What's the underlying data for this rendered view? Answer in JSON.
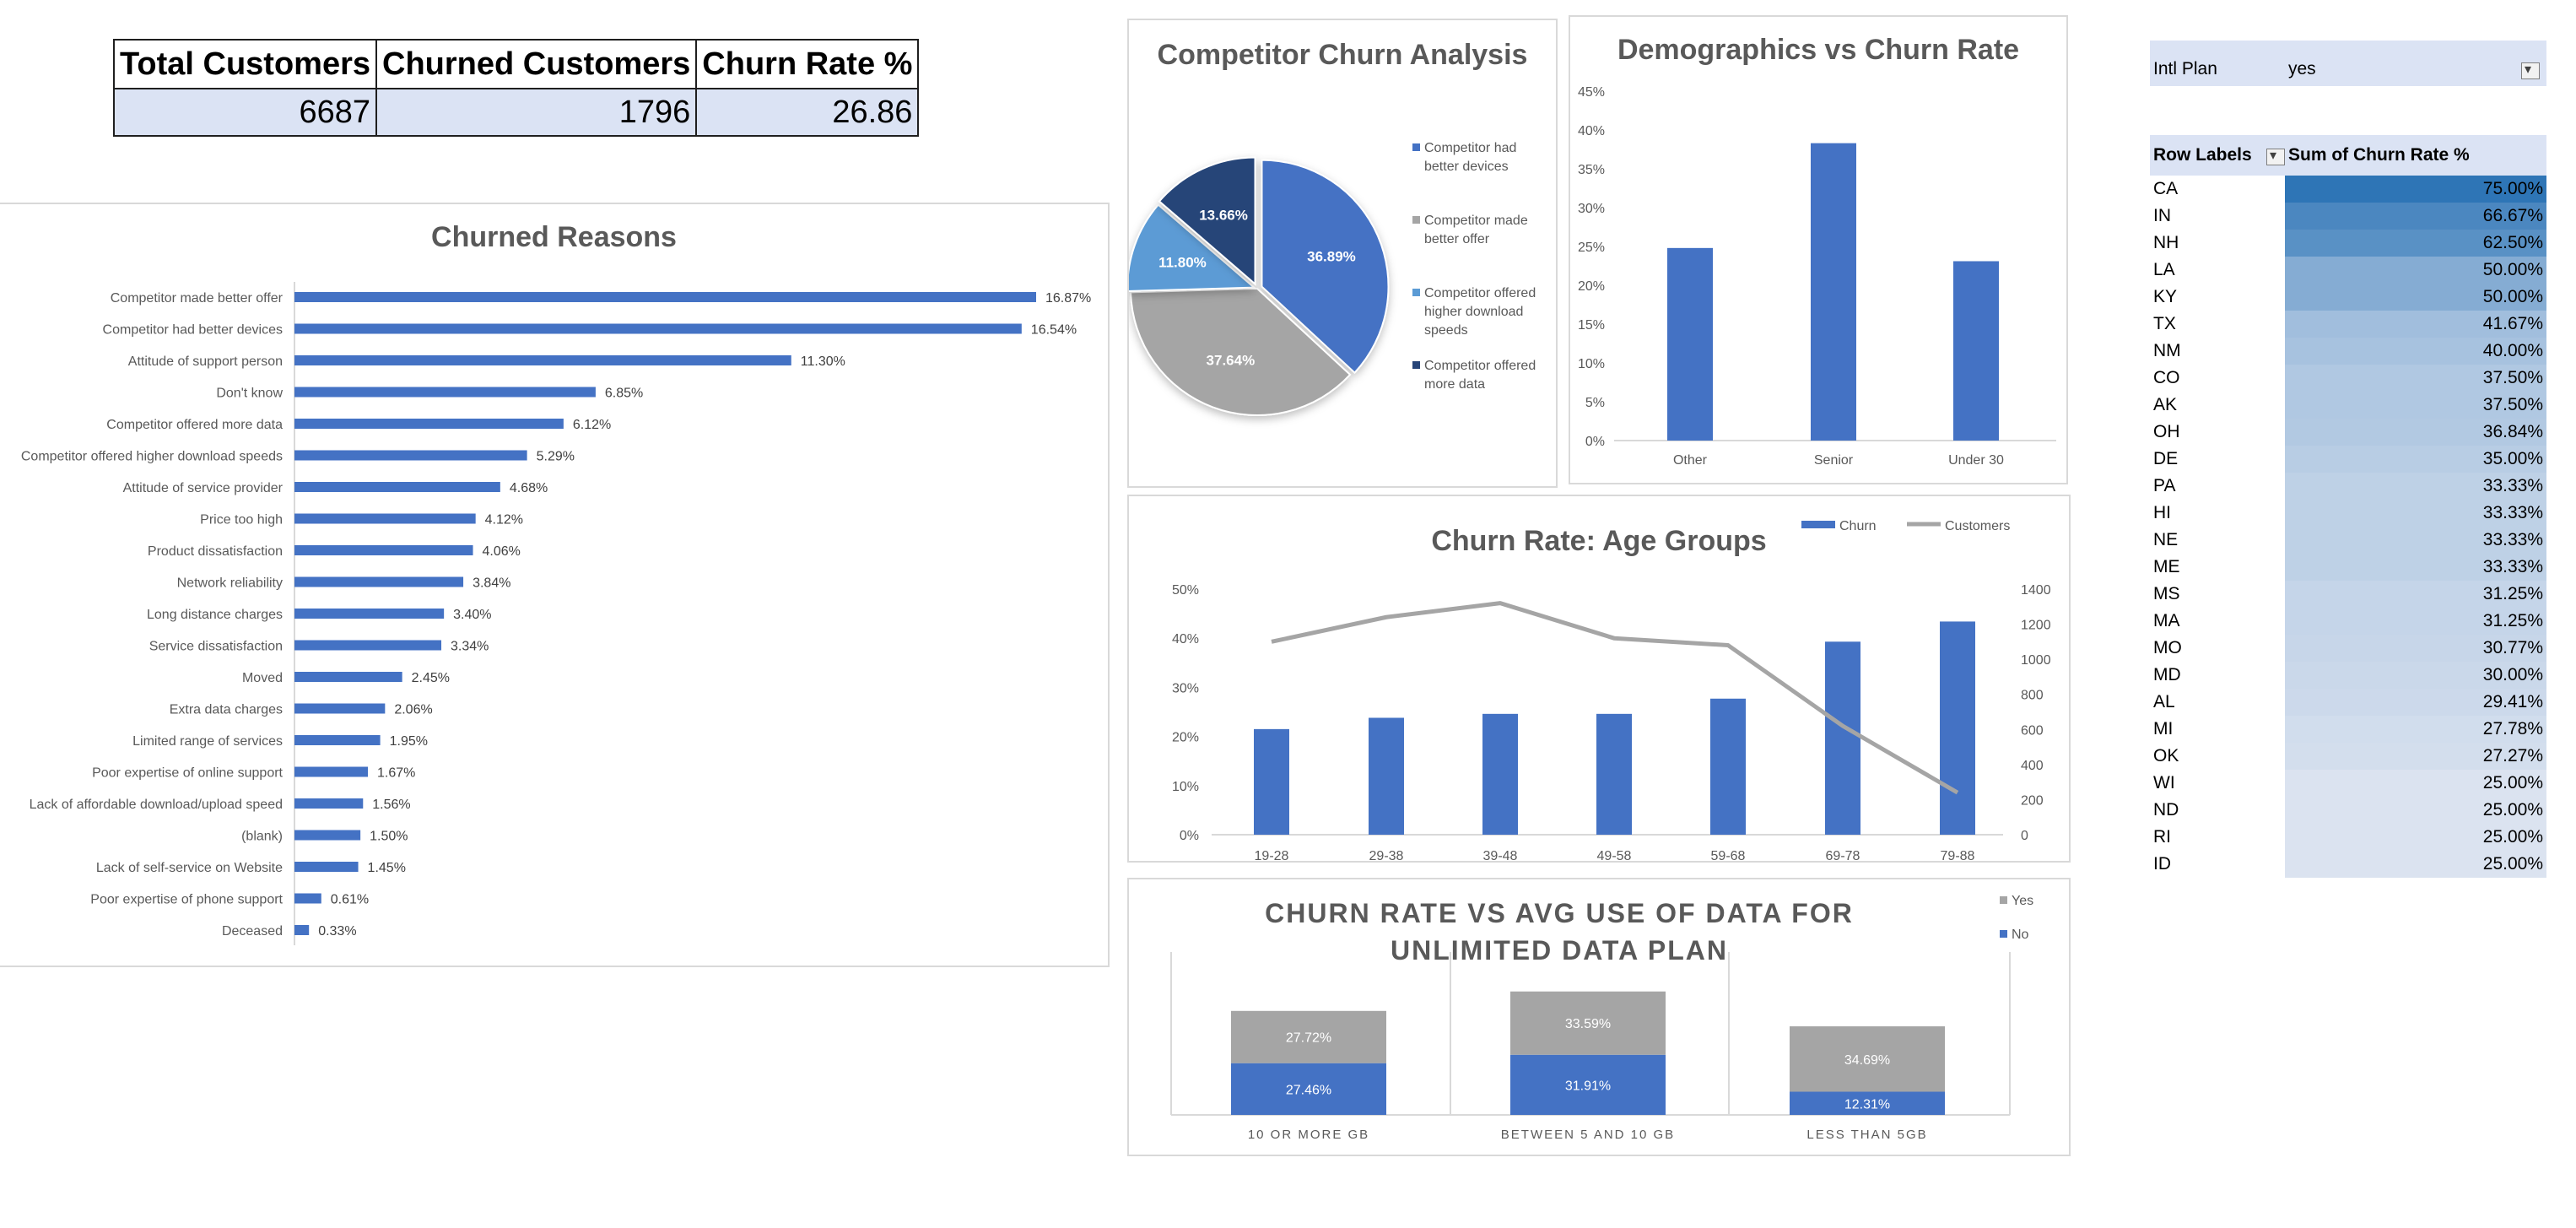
{
  "kpi": {
    "headers": [
      "Total Customers",
      "Churned Customers",
      "Churn Rate %"
    ],
    "values": [
      "6687",
      "1796",
      "26.86"
    ]
  },
  "colors": {
    "blue": "#4472c4",
    "gray": "#a5a5a5",
    "light_blue": "#5b9bd5",
    "navy": "#264478"
  },
  "chart_data": [
    {
      "type": "bar",
      "orientation": "horizontal",
      "title": "Churned Reasons",
      "categories": [
        "Competitor made better offer",
        "Competitor had better devices",
        "Attitude of support person",
        "Don't know",
        "Competitor offered more data",
        "Competitor offered higher download speeds",
        "Attitude of service provider",
        "Price too high",
        "Product dissatisfaction",
        "Network reliability",
        "Long distance charges",
        "Service dissatisfaction",
        "Moved",
        "Extra data charges",
        "Limited range of services",
        "Poor expertise of online support",
        "Lack of affordable download/upload speed",
        "(blank)",
        "Lack of self-service on Website",
        "Poor expertise of phone support",
        "Deceased"
      ],
      "values": [
        16.87,
        16.54,
        11.3,
        6.85,
        6.12,
        5.29,
        4.68,
        4.12,
        4.06,
        3.84,
        3.4,
        3.34,
        2.45,
        2.06,
        1.95,
        1.67,
        1.56,
        1.5,
        1.45,
        0.61,
        0.33
      ],
      "labels": [
        "16.87%",
        "16.54%",
        "11.30%",
        "6.85%",
        "6.12%",
        "5.29%",
        "4.68%",
        "4.12%",
        "4.06%",
        "3.84%",
        "3.40%",
        "3.34%",
        "2.45%",
        "2.06%",
        "1.95%",
        "1.67%",
        "1.56%",
        "1.50%",
        "1.45%",
        "0.61%",
        "0.33%"
      ]
    },
    {
      "type": "pie",
      "title": "Competitor Churn Analysis",
      "categories": [
        "Competitor had better devices",
        "Competitor made better offer",
        "Competitor offered higher download speeds",
        "Competitor offered more data"
      ],
      "values": [
        36.89,
        37.64,
        11.8,
        13.66
      ],
      "labels": [
        "36.89%",
        "37.64%",
        "11.80%",
        "13.66%"
      ],
      "legend_lines": [
        [
          "Competitor had",
          "better devices"
        ],
        [
          "Competitor made",
          "better offer"
        ],
        [
          "Competitor offered",
          "higher download",
          "speeds"
        ],
        [
          "Competitor offered",
          "more data"
        ]
      ],
      "legend": "right"
    },
    {
      "type": "bar",
      "title": "Demographics vs Churn Rate",
      "categories": [
        "Other",
        "Senior",
        "Under 30"
      ],
      "values": [
        24.8,
        38.3,
        23.1
      ],
      "ylim": [
        0,
        45
      ],
      "y_ticks": [
        "0%",
        "5%",
        "10%",
        "15%",
        "20%",
        "25%",
        "30%",
        "35%",
        "40%",
        "45%"
      ],
      "grid": false
    },
    {
      "type": "bar",
      "title": "Churn Rate: Age Groups",
      "categories": [
        "19-28",
        "29-38",
        "39-48",
        "49-58",
        "59-68",
        "69-78",
        "79-88"
      ],
      "series": [
        {
          "name": "Churn",
          "kind": "bar",
          "axis": "left",
          "values": [
            21.5,
            23.8,
            24.6,
            24.6,
            27.7,
            39.3,
            43.4
          ]
        },
        {
          "name": "Customers",
          "kind": "line",
          "axis": "right",
          "values": [
            1100,
            1240,
            1320,
            1120,
            1080,
            620,
            240
          ]
        }
      ],
      "ylim": [
        0,
        50
      ],
      "y_ticks": [
        "0%",
        "10%",
        "20%",
        "30%",
        "40%",
        "50%"
      ],
      "y2lim": [
        0,
        1400
      ],
      "y2_ticks": [
        "0",
        "200",
        "400",
        "600",
        "800",
        "1000",
        "1200",
        "1400"
      ],
      "legend": "top-right"
    },
    {
      "type": "bar",
      "stacked": true,
      "title": "CHURN RATE VS AVG USE OF DATA FOR UNLIMITED DATA PLAN",
      "categories": [
        "10 OR MORE GB",
        "BETWEEN 5 AND 10 GB",
        "LESS THAN 5GB"
      ],
      "series": [
        {
          "name": "No",
          "values": [
            27.46,
            31.91,
            12.31
          ],
          "labels": [
            "27.46%",
            "31.91%",
            "12.31%"
          ]
        },
        {
          "name": "Yes",
          "values": [
            27.72,
            33.59,
            34.69
          ],
          "labels": [
            "27.72%",
            "33.59%",
            "34.69%"
          ]
        }
      ],
      "legend": "top-right"
    },
    {
      "type": "table",
      "title": "",
      "filter_label": "Intl Plan",
      "filter_value": "yes",
      "columns": [
        "Row Labels",
        "Sum of Churn Rate %"
      ],
      "rows": [
        [
          "CA",
          "75.00%"
        ],
        [
          "IN",
          "66.67%"
        ],
        [
          "NH",
          "62.50%"
        ],
        [
          "LA",
          "50.00%"
        ],
        [
          "KY",
          "50.00%"
        ],
        [
          "TX",
          "41.67%"
        ],
        [
          "NM",
          "40.00%"
        ],
        [
          "CO",
          "37.50%"
        ],
        [
          "AK",
          "37.50%"
        ],
        [
          "OH",
          "36.84%"
        ],
        [
          "DE",
          "35.00%"
        ],
        [
          "PA",
          "33.33%"
        ],
        [
          "HI",
          "33.33%"
        ],
        [
          "NE",
          "33.33%"
        ],
        [
          "ME",
          "33.33%"
        ],
        [
          "MS",
          "31.25%"
        ],
        [
          "MA",
          "31.25%"
        ],
        [
          "MO",
          "30.77%"
        ],
        [
          "MD",
          "30.00%"
        ],
        [
          "AL",
          "29.41%"
        ],
        [
          "MI",
          "27.78%"
        ],
        [
          "OK",
          "27.27%"
        ],
        [
          "WI",
          "25.00%"
        ],
        [
          "ND",
          "25.00%"
        ],
        [
          "RI",
          "25.00%"
        ],
        [
          "ID",
          "25.00%"
        ]
      ],
      "values": [
        75.0,
        66.67,
        62.5,
        50.0,
        50.0,
        41.67,
        40.0,
        37.5,
        37.5,
        36.84,
        35.0,
        33.33,
        33.33,
        33.33,
        33.33,
        31.25,
        31.25,
        30.77,
        30.0,
        29.41,
        27.78,
        27.27,
        25.0,
        25.0,
        25.0,
        25.0
      ]
    }
  ]
}
